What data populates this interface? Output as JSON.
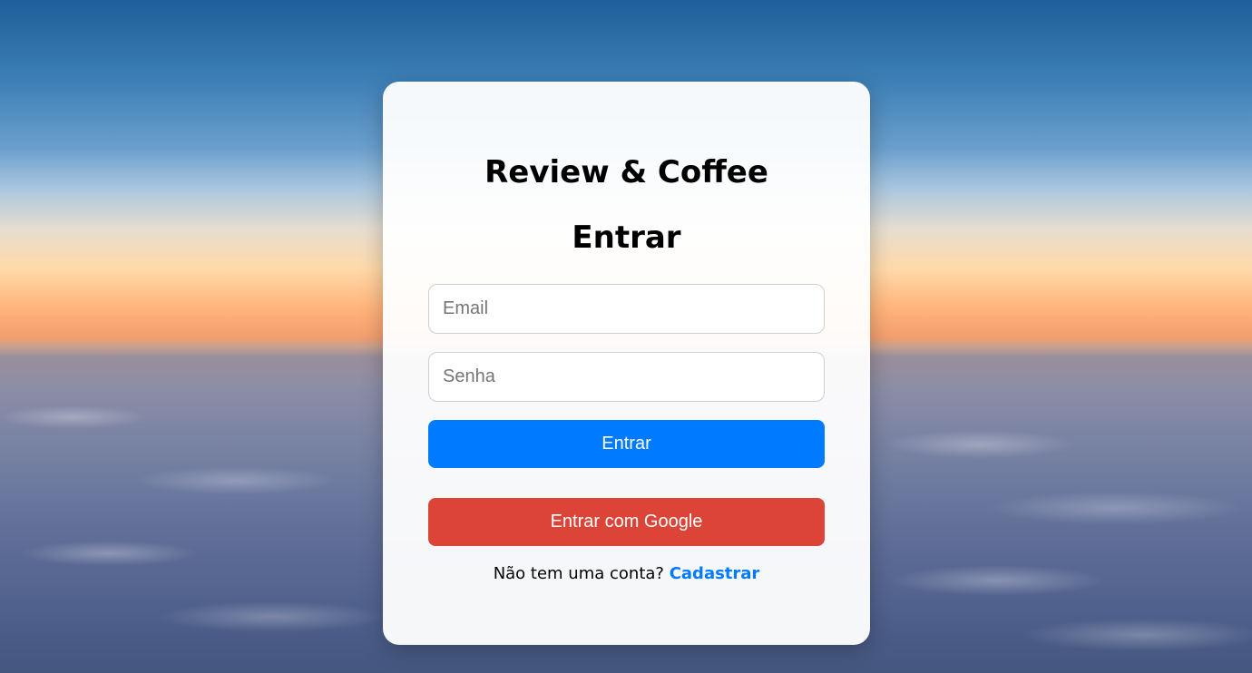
{
  "brand": "Review & Coffee",
  "heading": "Entrar",
  "form": {
    "email_placeholder": "Email",
    "password_placeholder": "Senha",
    "login_label": "Entrar",
    "google_label": "Entrar com Google"
  },
  "signup": {
    "prompt": "Não tem uma conta?",
    "link_label": "Cadastrar"
  },
  "colors": {
    "primary": "#007bff",
    "google": "#db4437"
  }
}
